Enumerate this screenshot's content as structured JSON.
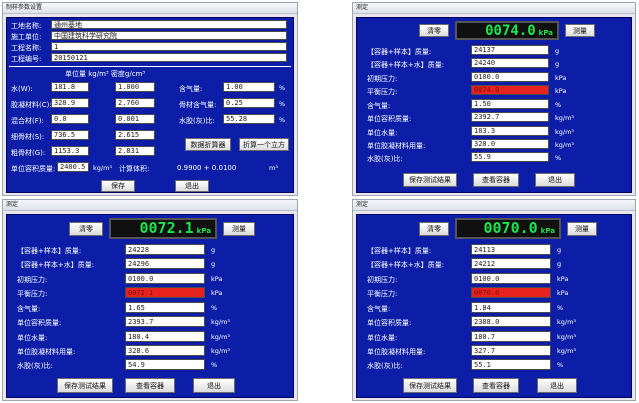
{
  "params_window": {
    "title": "制样参数设置",
    "company_label": "工地名称:",
    "company_value": "通州基地",
    "construction_label": "施工单位:",
    "construction_value": "中国建筑科学研究院",
    "project_label": "工程名称:",
    "project_value": "1",
    "project_no_label": "工程编号:",
    "project_no_value": "20150121",
    "header": "单位量 kg/m³   密度g/cm³",
    "rows": [
      {
        "label": "水(W):",
        "qty": "181.8",
        "density": "1.000"
      },
      {
        "label": "胶凝材料(C):",
        "qty": "328.9",
        "density": "2.760"
      },
      {
        "label": "混合材(F):",
        "qty": "0.0",
        "density": "0.001"
      },
      {
        "label": "细骨材(S):",
        "qty": "736.5",
        "density": "2.615"
      },
      {
        "label": "粗骨材(G):",
        "qty": "1153.3",
        "density": "2.831"
      }
    ],
    "air_label": "含气量:",
    "air_value": "1.00",
    "air_unit": "%",
    "aggregate_air_label": "骨材含气量:",
    "aggregate_air_value": "0.25",
    "aggregate_air_unit": "%",
    "wc_label": "水胶(灰)比:",
    "wc_value": "55.28",
    "wc_unit": "%",
    "fold_button": "数据折算器",
    "fold_cube_button": "折算一个立方",
    "unit_mass_label": "单位容积质量:",
    "unit_mass_value": "2400.5",
    "unit_mass_unit": "kg/m³",
    "calc_volume_label": "计算体积:",
    "calc_volume_value": "0.9900 + 0.0100",
    "calc_volume_unit": "m³",
    "save_button": "保存",
    "exit_button": "退出"
  },
  "tests": [
    {
      "title": "测定",
      "zero_button": "清零",
      "lcd_value": "0074.0",
      "lcd_unit": "kPa",
      "measure_button": "测量",
      "container_sample_label": "【容器+样本】质量:",
      "container_sample_value": "24137",
      "container_sample_unit": "g",
      "container_sample_water_label": "【容器+样本+水】质量:",
      "container_sample_water_value": "24240",
      "container_sample_water_unit": "g",
      "init_pressure_label": "初期压力:",
      "init_pressure_value": "0100.0",
      "init_pressure_unit": "kPa",
      "balance_pressure_label": "平衡压力:",
      "balance_pressure_value": "0074.0",
      "balance_pressure_unit": "kPa",
      "air_label": "含气量:",
      "air_value": "1.50",
      "air_unit": "%",
      "unit_mass_label": "单位容积质量:",
      "unit_mass_value": "2392.7",
      "unit_mass_unit": "kg/m³",
      "water_label": "单位水量:",
      "water_value": "183.3",
      "water_unit": "kg/m³",
      "binder_label": "单位胶凝材料用量:",
      "binder_value": "328.0",
      "binder_unit": "kg/m³",
      "wc_label": "水胶(灰)比:",
      "wc_value": "55.9",
      "wc_unit": "%",
      "save_button": "保存测试结果",
      "container_button": "查看容器",
      "exit_button": "退出"
    },
    {
      "title": "测定",
      "zero_button": "清零",
      "lcd_value": "0072.1",
      "lcd_unit": "kPa",
      "measure_button": "测量",
      "container_sample_label": "【容器+样本】质量:",
      "container_sample_value": "24228",
      "container_sample_unit": "g",
      "container_sample_water_label": "【容器+样本+水】质量:",
      "container_sample_water_value": "24296",
      "container_sample_water_unit": "g",
      "init_pressure_label": "初期压力:",
      "init_pressure_value": "0100.0",
      "init_pressure_unit": "kPa",
      "balance_pressure_label": "平衡压力:",
      "balance_pressure_value": "0072.1",
      "balance_pressure_unit": "kPa",
      "air_label": "含气量:",
      "air_value": "1.65",
      "air_unit": "%",
      "unit_mass_label": "单位容积质量:",
      "unit_mass_value": "2393.7",
      "unit_mass_unit": "kg/m³",
      "water_label": "单位水量:",
      "water_value": "180.4",
      "water_unit": "kg/m³",
      "binder_label": "单位胶凝材料用量:",
      "binder_value": "328.6",
      "binder_unit": "kg/m³",
      "wc_label": "水胶(灰)比:",
      "wc_value": "54.9",
      "wc_unit": "%",
      "save_button": "保存测试结果",
      "container_button": "查看容器",
      "exit_button": "退出"
    },
    {
      "title": "测定",
      "zero_button": "清零",
      "lcd_value": "0070.0",
      "lcd_unit": "kPa",
      "measure_button": "测量",
      "container_sample_label": "【容器+样本】质量:",
      "container_sample_value": "24113",
      "container_sample_unit": "g",
      "container_sample_water_label": "【容器+样本+水】质量:",
      "container_sample_water_value": "24212",
      "container_sample_water_unit": "g",
      "init_pressure_label": "初期压力:",
      "init_pressure_value": "0100.0",
      "init_pressure_unit": "kPa",
      "balance_pressure_label": "平衡压力:",
      "balance_pressure_value": "0070.0",
      "balance_pressure_unit": "kPa",
      "air_label": "含气量:",
      "air_value": "1.84",
      "air_unit": "%",
      "unit_mass_label": "单位容积质量:",
      "unit_mass_value": "2388.0",
      "unit_mass_unit": "kg/m³",
      "water_label": "单位水量:",
      "water_value": "180.7",
      "water_unit": "kg/m³",
      "binder_label": "单位胶凝材料用量:",
      "binder_value": "327.7",
      "binder_unit": "kg/m³",
      "wc_label": "水胶(灰)比:",
      "wc_value": "55.1",
      "wc_unit": "%",
      "save_button": "保存测试结果",
      "container_button": "查看容器",
      "exit_button": "退出"
    }
  ]
}
